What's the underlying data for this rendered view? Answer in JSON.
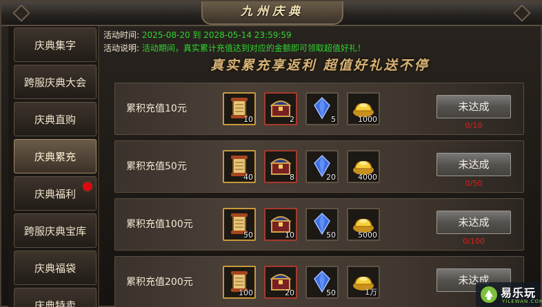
{
  "window": {
    "title": "九州庆典"
  },
  "sidebar": {
    "items": [
      {
        "label": "庆典集字",
        "active": false,
        "badge": false
      },
      {
        "label": "跨服庆典大会",
        "active": false,
        "badge": false
      },
      {
        "label": "庆典直购",
        "active": false,
        "badge": false
      },
      {
        "label": "庆典累充",
        "active": true,
        "badge": false
      },
      {
        "label": "庆典福利",
        "active": false,
        "badge": true
      },
      {
        "label": "跨服庆典宝库",
        "active": false,
        "badge": false
      },
      {
        "label": "庆典福袋",
        "active": false,
        "badge": false
      },
      {
        "label": "庆典特卖",
        "active": false,
        "badge": false
      }
    ]
  },
  "activity": {
    "time_label": "活动时间:",
    "time_value": "2025-08-20 到 2028-05-14 23:59:59",
    "desc_label": "活动说明:",
    "desc_value": "活动期间，真实累计充值达到对应的金额即可领取超值好礼！"
  },
  "banner": "真实累充享返利 超值好礼送不停",
  "rows": [
    {
      "label": "累积充值10元",
      "items": [
        {
          "icon": "scroll-icon",
          "count": "10"
        },
        {
          "icon": "treasure-chest-icon",
          "count": "2"
        },
        {
          "icon": "blue-gem-icon",
          "count": "5"
        },
        {
          "icon": "gold-ingot-icon",
          "count": "1000"
        }
      ],
      "button": "未达成",
      "progress": "0/10"
    },
    {
      "label": "累积充值50元",
      "items": [
        {
          "icon": "scroll-icon",
          "count": "40"
        },
        {
          "icon": "treasure-chest-icon",
          "count": "8"
        },
        {
          "icon": "blue-gem-icon",
          "count": "20"
        },
        {
          "icon": "gold-ingot-icon",
          "count": "4000"
        }
      ],
      "button": "未达成",
      "progress": "0/50"
    },
    {
      "label": "累积充值100元",
      "items": [
        {
          "icon": "scroll-icon",
          "count": "50"
        },
        {
          "icon": "treasure-chest-icon",
          "count": "10"
        },
        {
          "icon": "blue-gem-icon",
          "count": "50"
        },
        {
          "icon": "gold-ingot-icon",
          "count": "5000"
        }
      ],
      "button": "未达成",
      "progress": "0/100"
    },
    {
      "label": "累积充值200元",
      "items": [
        {
          "icon": "scroll-icon",
          "count": "100"
        },
        {
          "icon": "treasure-chest-icon",
          "count": "20"
        },
        {
          "icon": "blue-gem-icon",
          "count": "50"
        },
        {
          "icon": "gold-ingot-icon",
          "count": "1万"
        }
      ],
      "button": "未达成",
      "progress": ""
    }
  ],
  "watermark": {
    "text": "易乐玩",
    "sub": "YILEWAN.COM"
  }
}
